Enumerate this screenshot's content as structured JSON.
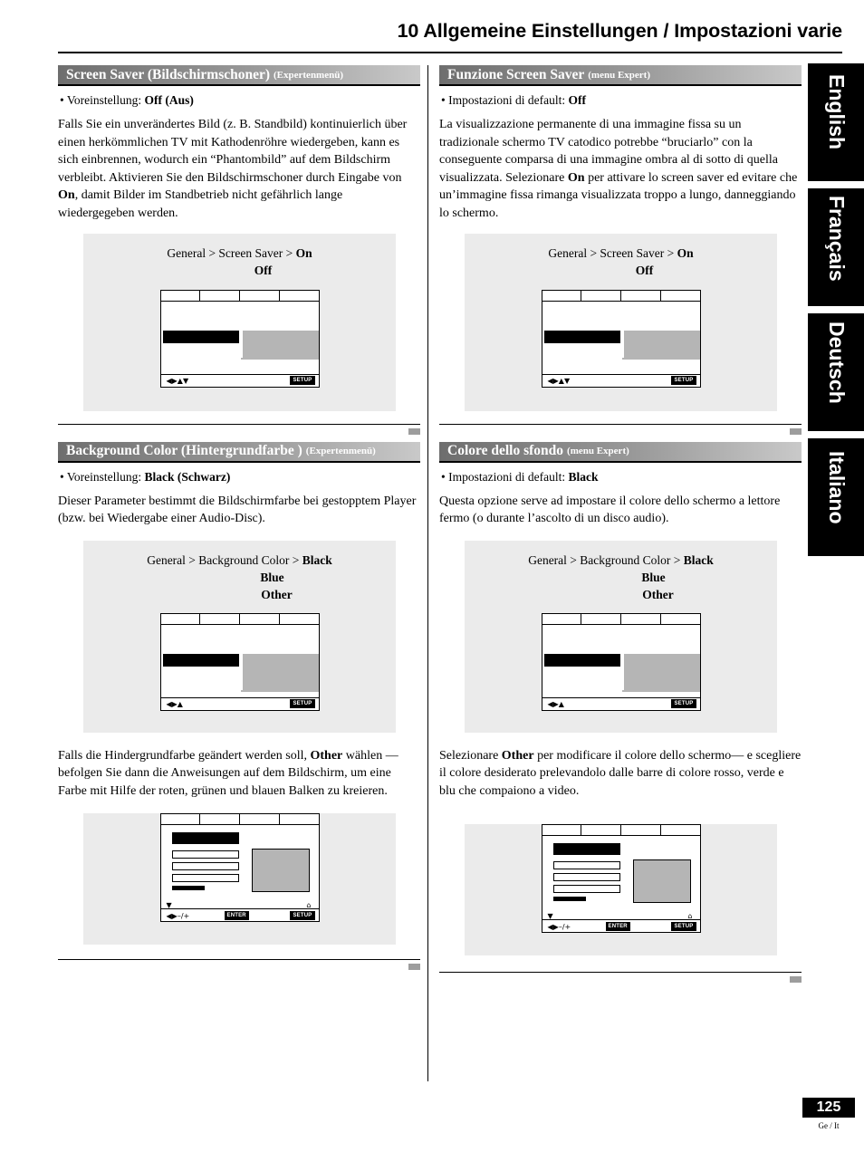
{
  "header": {
    "title": "10 Allgemeine Einstellungen / Impostazioni varie"
  },
  "side_tabs": [
    {
      "label": "English"
    },
    {
      "label": "Français"
    },
    {
      "label": "Deutsch"
    },
    {
      "label": "Italiano"
    }
  ],
  "left_column": {
    "section1": {
      "heading_main": "Screen Saver (Bildschirmschoner)",
      "heading_sub": "(Expertenmenü)",
      "default_label": "• Voreinstellung: ",
      "default_value": "Off (Aus)",
      "body": "Falls Sie ein unverändertes Bild (z. B. Standbild) kontinuierlich über einen herkömmlichen TV mit Kathodenröhre wiedergeben, kann es sich einbrennen, wodurch ein “Phantombild” auf dem Bildschirm verbleibt. Aktivieren Sie den Bildschirmschoner durch Eingabe von",
      "body_bold": "On",
      "body_tail": ", damit Bilder im Standbetrieb nicht gefährlich lange wiedergegeben werden.",
      "figure": {
        "path_prefix": "General > Screen Saver > ",
        "path_selected": "On",
        "options": "Off",
        "footer_badge": "SETUP"
      }
    },
    "section2": {
      "heading_main": "Background Color (Hintergrundfarbe )",
      "heading_sub": "(Expertenmenü)",
      "default_label": "• Voreinstellung: ",
      "default_value": "Black (Schwarz)",
      "body": "Dieser Parameter bestimmt die Bildschirmfarbe bei gestopptem Player (bzw. bei Wiedergabe einer Audio-Disc).",
      "figure": {
        "path_prefix": "General > Background Color > ",
        "path_selected": "Black",
        "option1": "Blue",
        "option2": "Other",
        "footer_badge": "SETUP"
      },
      "body2_a": "Falls die Hindergrundfarbe geändert werden soll, ",
      "body2_bold": "Other",
      "body2_b": " wählen — befolgen Sie dann die Anweisungen auf dem Bildschirm, um eine Farbe mit Hilfe der roten, grünen und blauen Balken zu kreieren.",
      "figure2": {
        "badge_enter": "ENTER",
        "badge_setup": "SETUP",
        "glyph_minusplus": "–/+"
      }
    }
  },
  "right_column": {
    "section1": {
      "heading_main": "Funzione Screen Saver",
      "heading_sub": "(menu Expert)",
      "default_label": "• Impostazioni di default: ",
      "default_value": "Off",
      "body": "La visualizzazione permanente di una immagine fissa su un tradizionale schermo TV catodico potrebbe “bruciarlo” con la conseguente comparsa di una immagine ombra al di sotto di quella visualizzata. Selezionare",
      "body_bold": "On",
      "body_tail": " per  attivare lo screen saver ed evitare che un’immagine fissa rimanga visualizzata troppo a lungo, danneggiando lo schermo.",
      "figure": {
        "path_prefix": "General > Screen Saver > ",
        "path_selected": "On",
        "options": "Off",
        "footer_badge": "SETUP"
      }
    },
    "section2": {
      "heading_main": "Colore dello sfondo",
      "heading_sub": "(menu Expert)",
      "default_label": "• Impostazioni di default: ",
      "default_value": "Black",
      "body": "Questa opzione serve ad impostare il colore dello schermo a lettore fermo (o durante l’ascolto di un disco audio).",
      "figure": {
        "path_prefix": "General > Background Color > ",
        "path_selected": "Black",
        "option1": "Blue",
        "option2": "Other",
        "footer_badge": "SETUP"
      },
      "body2_a": "Selezionare ",
      "body2_bold": "Other",
      "body2_b": " per modificare il colore dello schermo— e scegliere il colore desiderato prelevandolo dalle barre di colore rosso, verde e blu che compaiono a video.",
      "figure2": {
        "badge_enter": "ENTER",
        "badge_setup": "SETUP",
        "glyph_minusplus": "–/+"
      }
    }
  },
  "footer": {
    "page_number": "125",
    "page_label": "Ge / It"
  }
}
